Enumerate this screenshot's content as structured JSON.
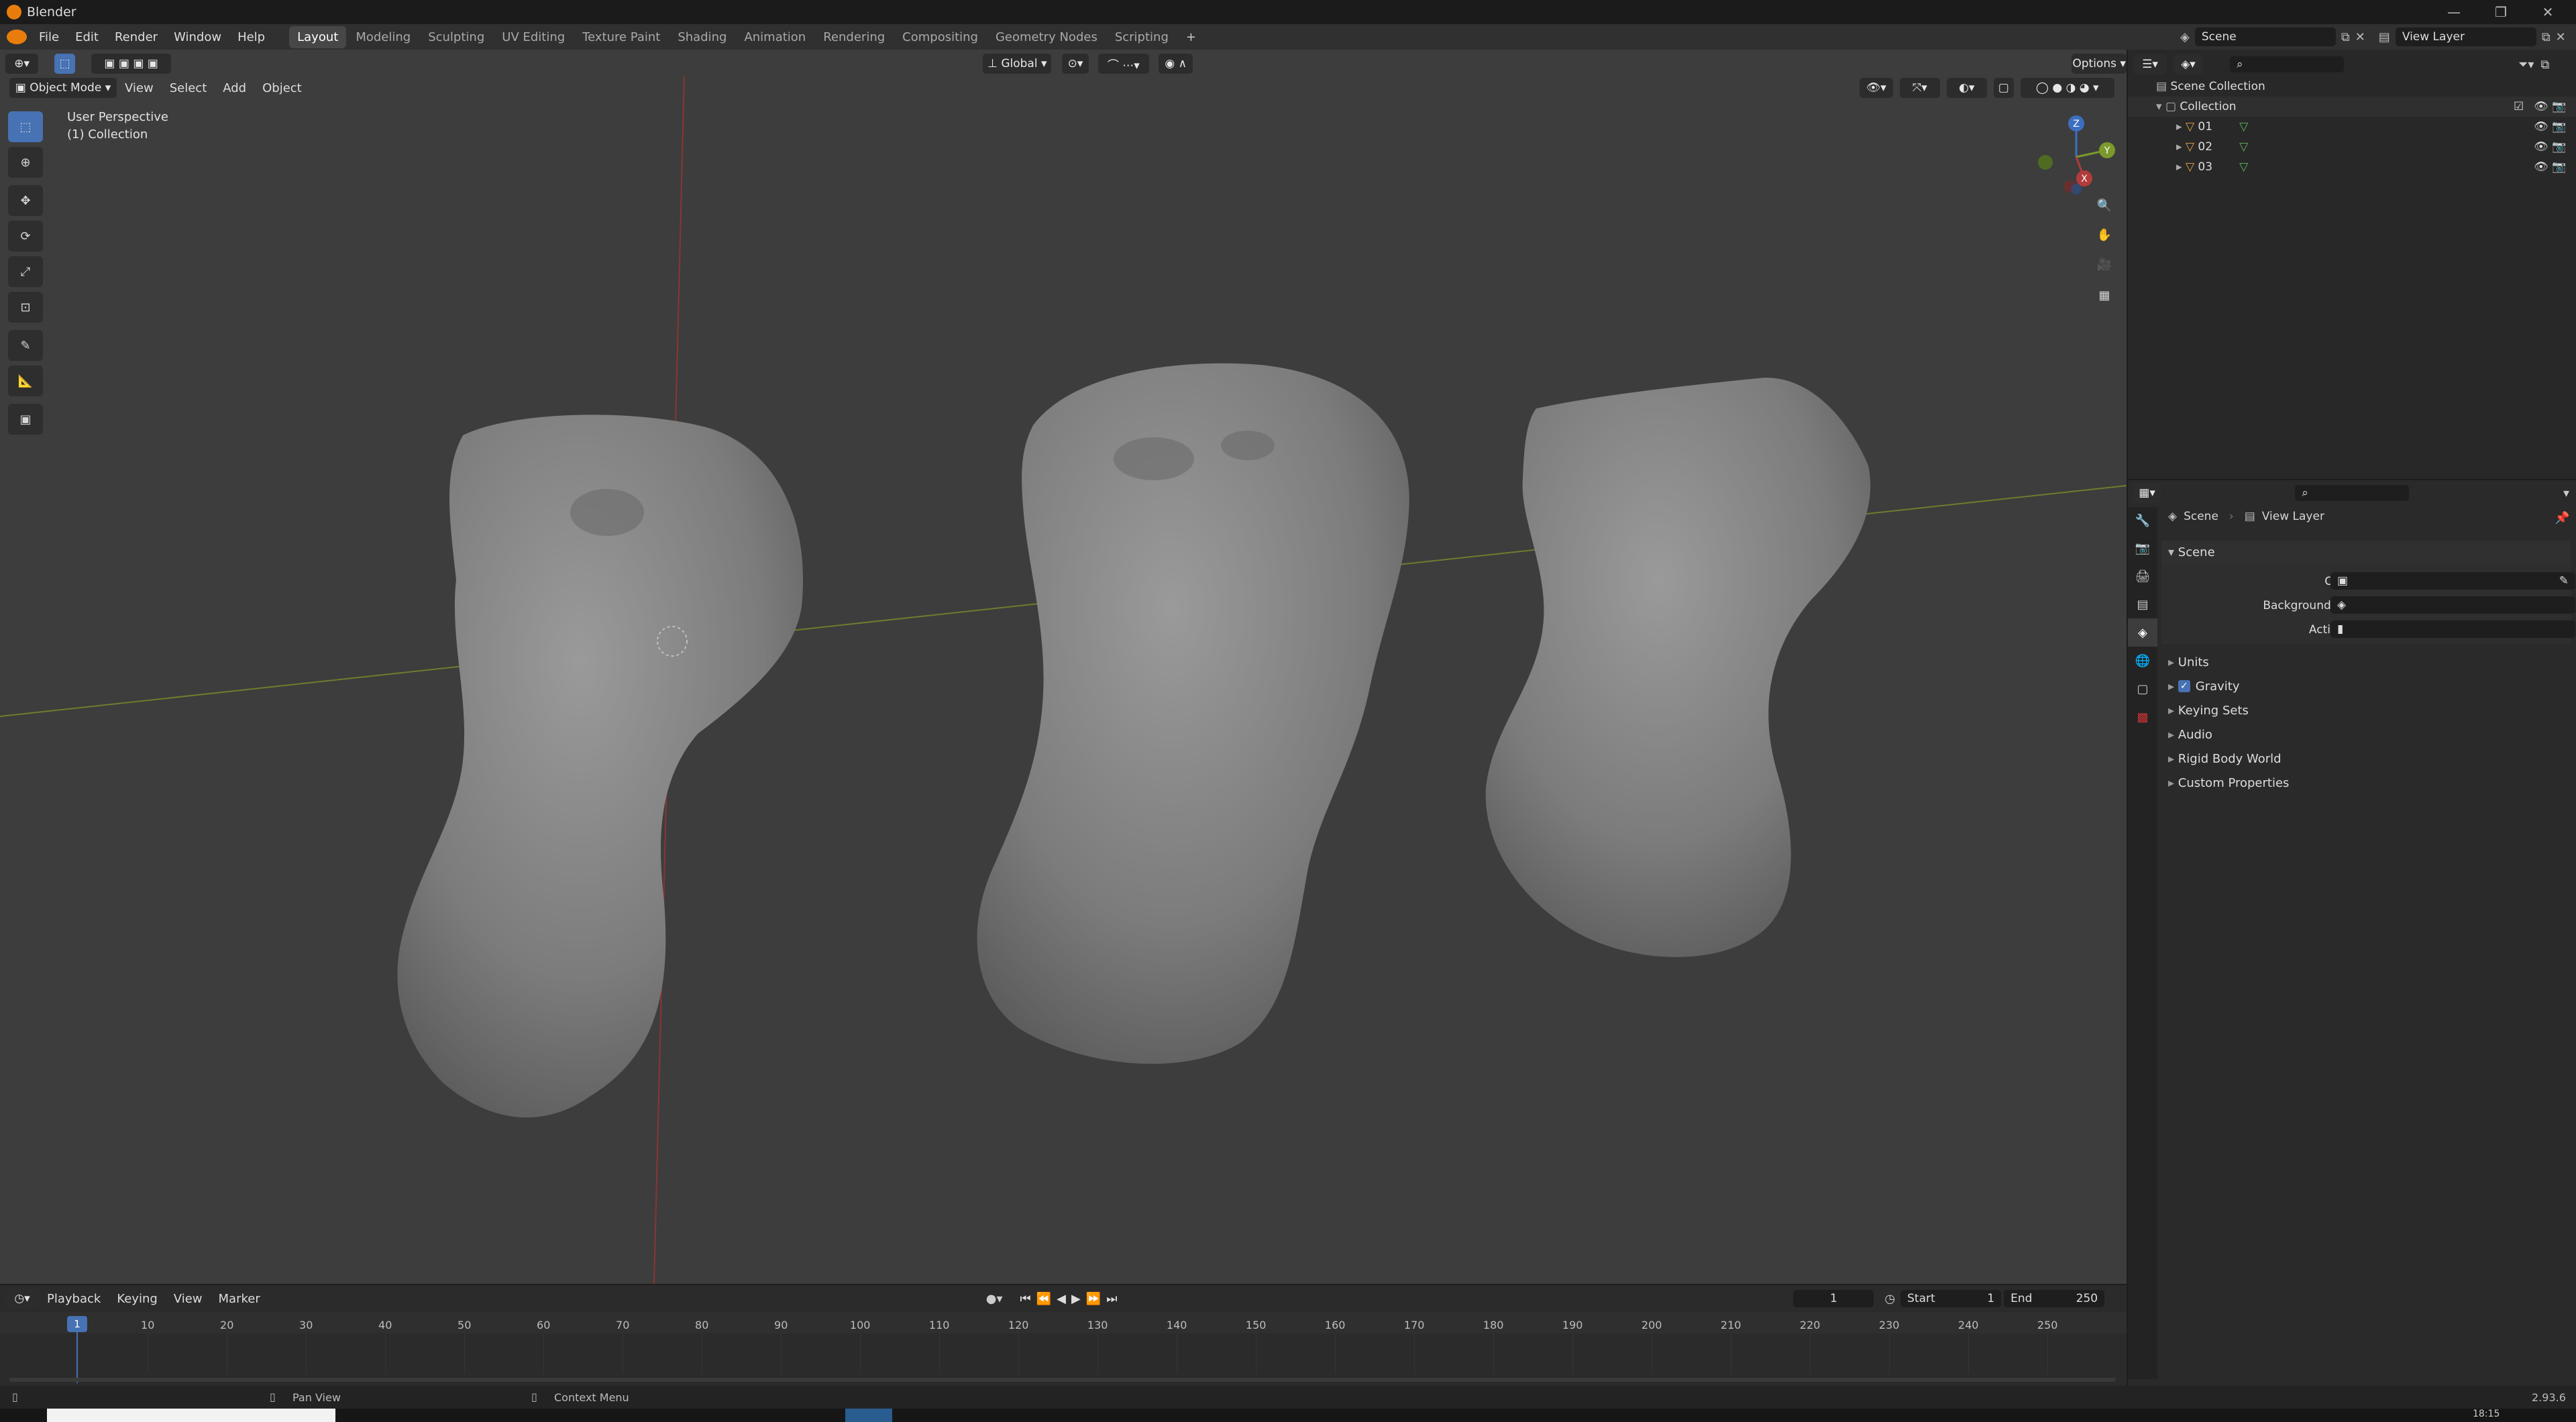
{
  "window": {
    "title": "Blender"
  },
  "menu": [
    "File",
    "Edit",
    "Render",
    "Window",
    "Help"
  ],
  "workspaces": [
    "Layout",
    "Modeling",
    "Sculpting",
    "UV Editing",
    "Texture Paint",
    "Shading",
    "Animation",
    "Rendering",
    "Compositing",
    "Geometry Nodes",
    "Scripting"
  ],
  "active_workspace": "Layout",
  "scene_selector": {
    "scene": "Scene",
    "view_layer": "View Layer"
  },
  "viewport": {
    "mode": "Object Mode",
    "menu": [
      "View",
      "Select",
      "Add",
      "Object"
    ],
    "transform_orientation": "Global",
    "options_label": "Options",
    "overlay_text": {
      "perspective": "User Perspective",
      "collection": "(1) Collection"
    },
    "gizmo_axes": [
      "Z",
      "Y",
      "X"
    ]
  },
  "outliner": {
    "root": "Scene Collection",
    "collection": "Collection",
    "objects": [
      "01",
      "02",
      "03"
    ]
  },
  "properties": {
    "breadcrumb": [
      "Scene",
      "View Layer"
    ],
    "panel_title": "Scene",
    "fields": {
      "camera": "Camera",
      "background_scene": "Background Scene",
      "active_clip": "Active Clip"
    },
    "subpanels": [
      "Units",
      "Gravity",
      "Keying Sets",
      "Audio",
      "Rigid Body World",
      "Custom Properties"
    ],
    "gravity_checked": true
  },
  "timeline": {
    "menu": [
      "Playback",
      "Keying",
      "View",
      "Marker"
    ],
    "current_frame": "1",
    "start_label": "Start",
    "start": "1",
    "end_label": "End",
    "end": "250",
    "ticks": [
      "1",
      "10",
      "20",
      "30",
      "40",
      "50",
      "60",
      "70",
      "80",
      "90",
      "100",
      "110",
      "120",
      "130",
      "140",
      "150",
      "160",
      "170",
      "180",
      "190",
      "200",
      "210",
      "220",
      "230",
      "240",
      "250"
    ]
  },
  "statusbar": {
    "left_hint": "Pan View",
    "right_hint": "Context Menu",
    "version": "2.93.6"
  },
  "taskbar": {
    "clock": "18:15"
  },
  "colors": {
    "accent": "#4772b3",
    "x_axis": "#b23b3b",
    "y_axis": "#7a9a2c",
    "z_axis": "#3c6fc0",
    "mesh": "#7e7e7e"
  }
}
